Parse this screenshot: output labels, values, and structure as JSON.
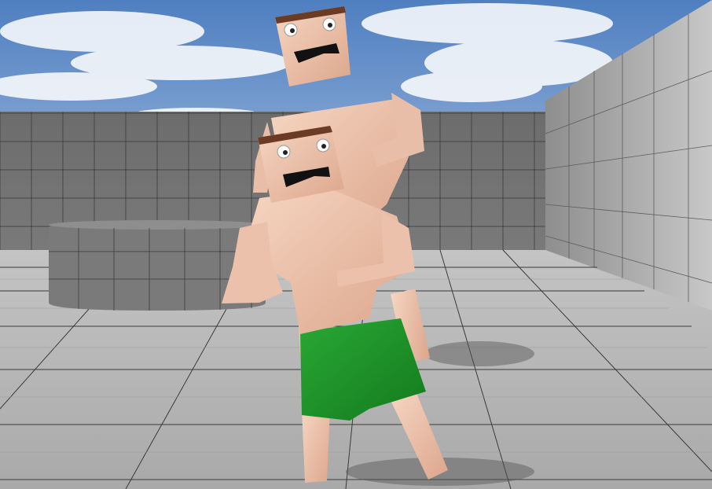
{
  "app": {
    "view": "3d-game-viewport"
  },
  "scene": {
    "sky_colors": [
      "#4f7fc0",
      "#a9c1e3"
    ],
    "floor_color": "#b9b9b9",
    "wall_color": "#707070",
    "grid_line_color": "#2e2e2e",
    "skin_color": "#f0c9b2",
    "shorts_color": "#1f8f2a",
    "hair_color": "#6b3b25"
  },
  "characters": [
    {
      "role": "rear-character",
      "pose": "flexing",
      "shorts": "green"
    },
    {
      "role": "front-character",
      "pose": "flexing",
      "shorts": "green"
    }
  ]
}
